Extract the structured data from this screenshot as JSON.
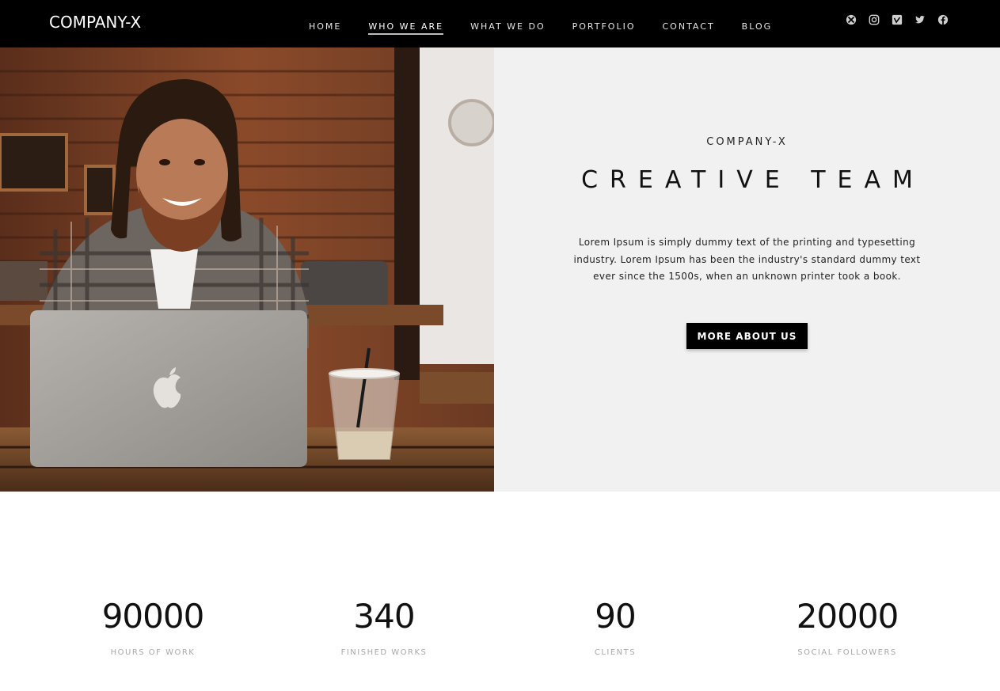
{
  "header": {
    "logo": "COMPANY-X",
    "nav": [
      "HOME",
      "WHO WE ARE",
      "WHAT WE DO",
      "PORTFOLIO",
      "CONTACT",
      "BLOG"
    ],
    "active_nav": "WHO WE ARE",
    "social_icons": [
      "xbox-icon",
      "instagram-icon",
      "vimeo-icon",
      "twitter-icon",
      "facebook-icon"
    ]
  },
  "hero": {
    "eyebrow": "COMPANY-X",
    "title": "CREATIVE TEAM",
    "paragraph_lines": [
      "Lorem Ipsum is simply dummy text of the printing and typesetting",
      "industry. Lorem Ipsum has been the industry's standard dummy text",
      "ever since the 1500s, when an unknown printer took a book."
    ],
    "cta_label": "MORE ABOUT US"
  },
  "stats": [
    {
      "value": "90000",
      "label": "HOURS OF WORK"
    },
    {
      "value": "340",
      "label": "FINISHED WORKS"
    },
    {
      "value": "90",
      "label": "CLIENTS"
    },
    {
      "value": "20000",
      "label": "SOCIAL FOLLOWERS"
    }
  ],
  "colors": {
    "header_bg": "#000000",
    "panel_bg": "#f1f1f1",
    "button_bg": "#000000",
    "stat_label": "#a8a8a8"
  }
}
